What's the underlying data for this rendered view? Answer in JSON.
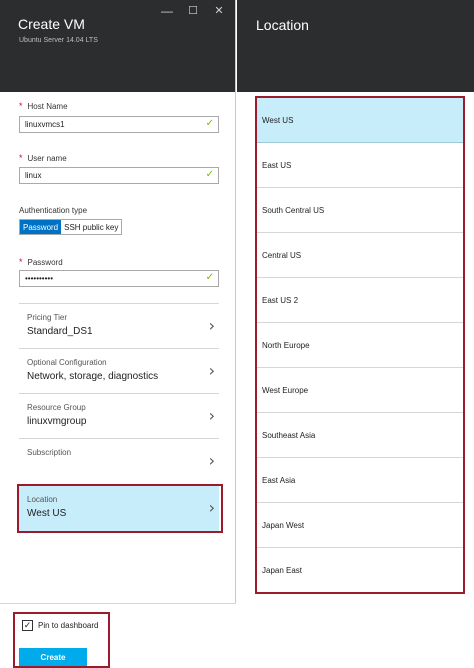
{
  "create_vm": {
    "title": "Create VM",
    "subtitle": "Ubuntu Server 14.04 LTS",
    "host_name": {
      "label": "Host Name",
      "value": "linuxvmcs1"
    },
    "user_name": {
      "label": "User name",
      "value": "linux"
    },
    "auth": {
      "label": "Authentication type",
      "options": [
        "Password",
        "SSH public key"
      ],
      "selected": "Password"
    },
    "password": {
      "label": "Password",
      "value": "••••••••••"
    },
    "required_mark": "*",
    "check_glyph": "✓",
    "nav": [
      {
        "label": "Pricing Tier",
        "value": "Standard_DS1"
      },
      {
        "label": "Optional Configuration",
        "value": "Network, storage, diagnostics"
      },
      {
        "label": "Resource Group",
        "value": "linuxvmgroup"
      },
      {
        "label": "Subscription",
        "value": ""
      },
      {
        "label": "Location",
        "value": "West US"
      }
    ],
    "chevron_glyph": "›",
    "pin_label": "Pin to dashboard",
    "pin_checked": true,
    "create_label": "Create"
  },
  "location_blade": {
    "title": "Location",
    "selected": "West US",
    "items": [
      "West US",
      "East US",
      "South Central US",
      "Central US",
      "East US 2",
      "North Europe",
      "West Europe",
      "Southeast Asia",
      "East Asia",
      "Japan West",
      "Japan East"
    ]
  },
  "window_controls": {
    "minimize": "—",
    "maximize": "☐",
    "close": "✕"
  },
  "colors": {
    "header_bg": "#2b2d2f",
    "accent_blue": "#0072c6",
    "selected_bg": "#c7ecfa",
    "create_button": "#00abec",
    "valid_check": "#7fba00",
    "highlight_border": "#9b1b2b"
  }
}
